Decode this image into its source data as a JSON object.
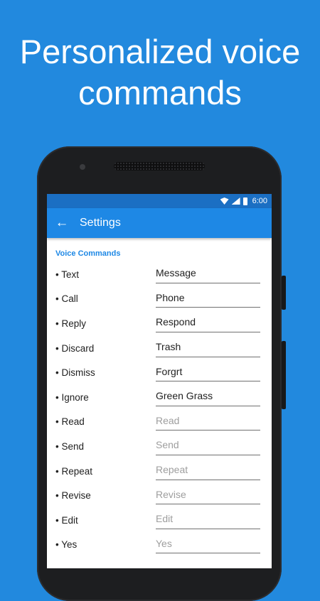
{
  "headline": {
    "line1": "Personalized voice",
    "line2": "commands"
  },
  "status_bar": {
    "time": "6:00",
    "icons": [
      "wifi-icon",
      "signal-icon",
      "battery-icon"
    ]
  },
  "app_bar": {
    "back_icon": "arrow-left-icon",
    "title": "Settings"
  },
  "section": {
    "title": "Voice Commands"
  },
  "rows": [
    {
      "label": "• Text",
      "value": "Message",
      "placeholder": ""
    },
    {
      "label": "• Call",
      "value": "Phone",
      "placeholder": ""
    },
    {
      "label": "• Reply",
      "value": "Respond",
      "placeholder": ""
    },
    {
      "label": "• Discard",
      "value": "Trash",
      "placeholder": ""
    },
    {
      "label": "• Dismiss",
      "value": "Forgrt",
      "placeholder": ""
    },
    {
      "label": "• Ignore",
      "value": "Green Grass",
      "placeholder": ""
    },
    {
      "label": "• Read",
      "value": "",
      "placeholder": "Read"
    },
    {
      "label": "• Send",
      "value": "",
      "placeholder": "Send"
    },
    {
      "label": "• Repeat",
      "value": "",
      "placeholder": "Repeat"
    },
    {
      "label": "• Revise",
      "value": "",
      "placeholder": "Revise"
    },
    {
      "label": "• Edit",
      "value": "",
      "placeholder": "Edit"
    },
    {
      "label": "• Yes",
      "value": "",
      "placeholder": "Yes"
    }
  ],
  "colors": {
    "background": "#2289de",
    "app_bar": "#1e88e5",
    "status_bar": "#1b6fc3",
    "accent": "#1e88e5"
  }
}
